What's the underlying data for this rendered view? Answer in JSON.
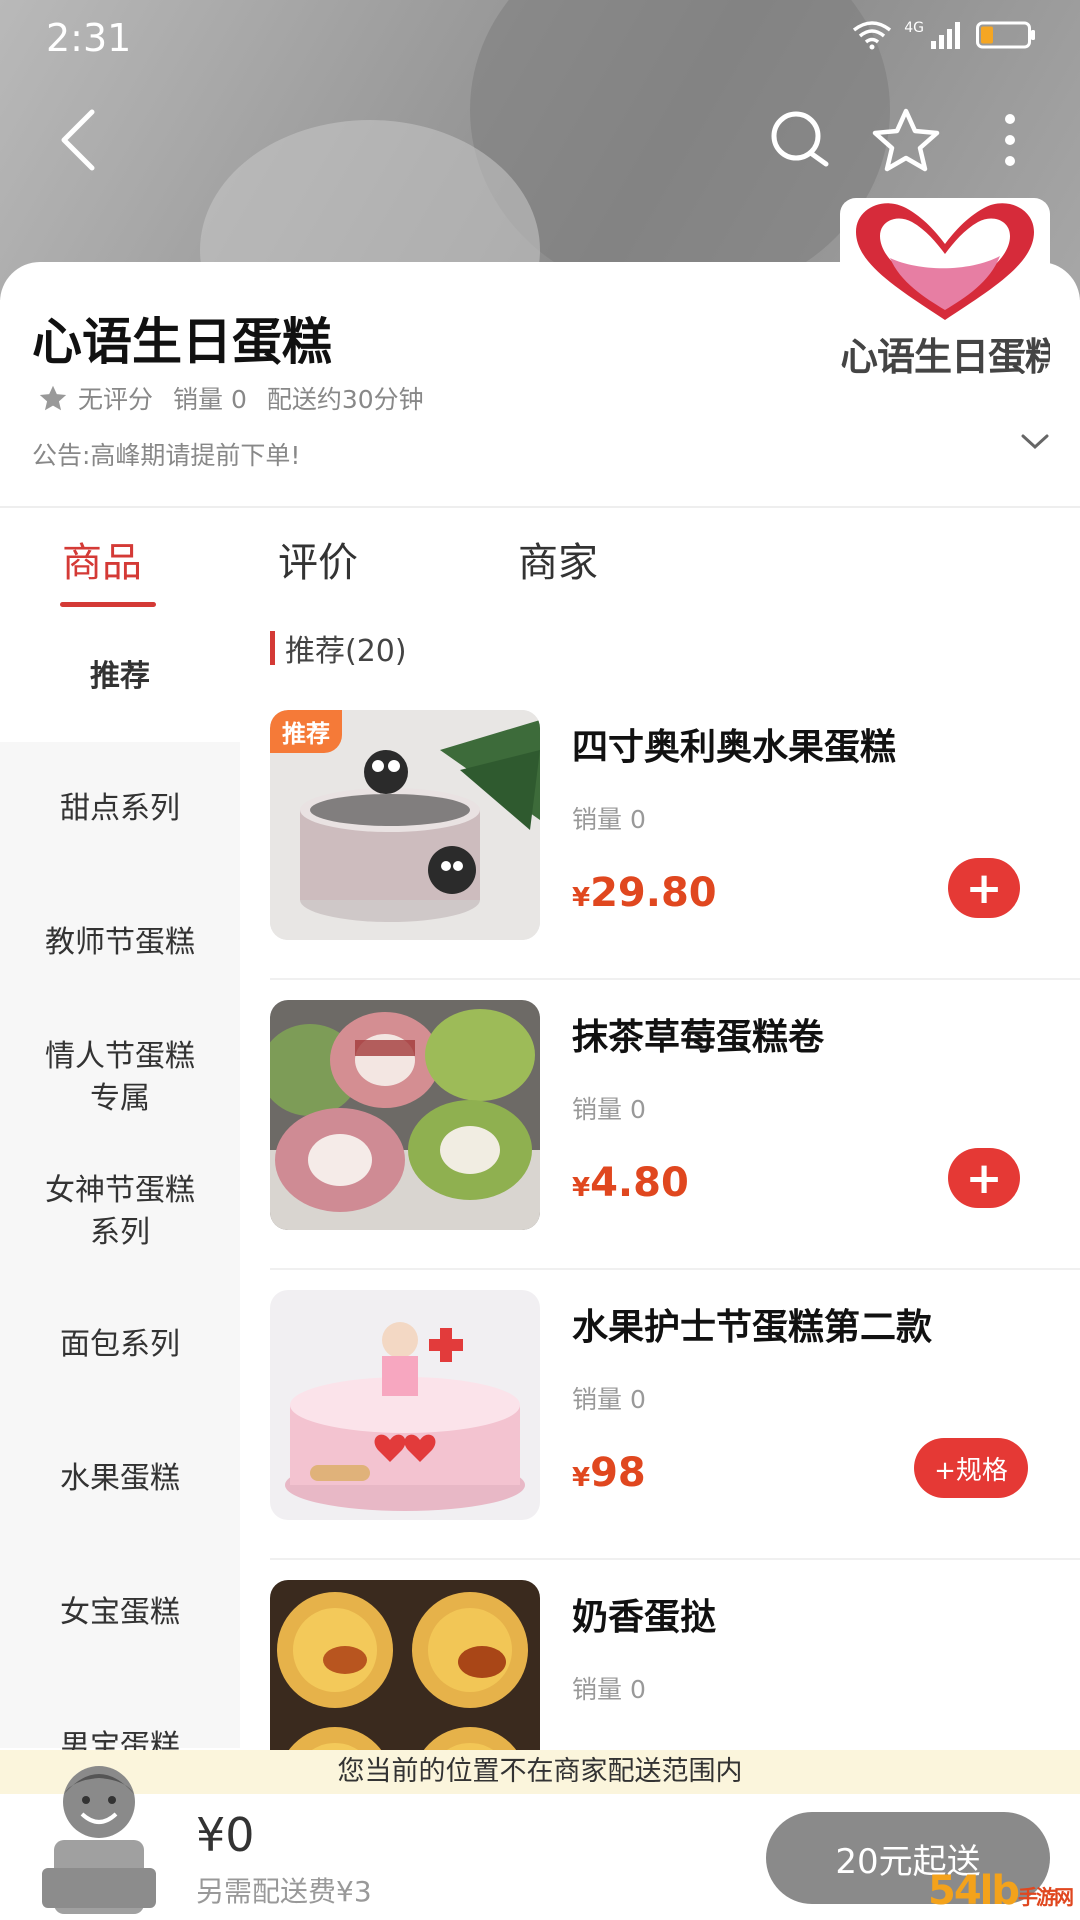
{
  "status": {
    "time": "2:31",
    "network": "4G"
  },
  "store": {
    "name": "心语生日蛋糕",
    "logo_text": "心语生日蛋糕",
    "rating": "无评分",
    "sales": "销量 0",
    "delivery": "配送约30分钟",
    "notice": "公告:高峰期请提前下单!"
  },
  "tabs": [
    "商品",
    "评价",
    "商家"
  ],
  "sidebar": [
    "推荐",
    "甜点系列",
    "教师节蛋糕",
    "情人节蛋糕\n专属",
    "女神节蛋糕\n系列",
    "面包系列",
    "水果蛋糕",
    "女宝蛋糕",
    "男宝蛋糕"
  ],
  "section_title": "推荐(20)",
  "products": [
    {
      "name": "四寸奥利奥水果蛋糕",
      "sales": "销量 0",
      "currency": "¥",
      "price": "29.80",
      "tag": "推荐",
      "button": "+"
    },
    {
      "name": "抹茶草莓蛋糕卷",
      "sales": "销量 0",
      "currency": "¥",
      "price": "4.80",
      "button": "+"
    },
    {
      "name": "水果护士节蛋糕第二款",
      "sales": "销量 0",
      "currency": "¥",
      "price": "98",
      "button": "+规格"
    },
    {
      "name": "奶香蛋挞",
      "sales": "销量 0"
    }
  ],
  "cart": {
    "warning": "您当前的位置不在商家配送范围内",
    "total": "¥0",
    "delivery_fee": "另需配送费¥3",
    "min_order_button": "20元起送"
  },
  "watermark": {
    "text": "54lb",
    "sub": "手游网"
  },
  "colors": {
    "accent": "#d43a36",
    "price": "#e0471f",
    "button": "#e53935"
  }
}
